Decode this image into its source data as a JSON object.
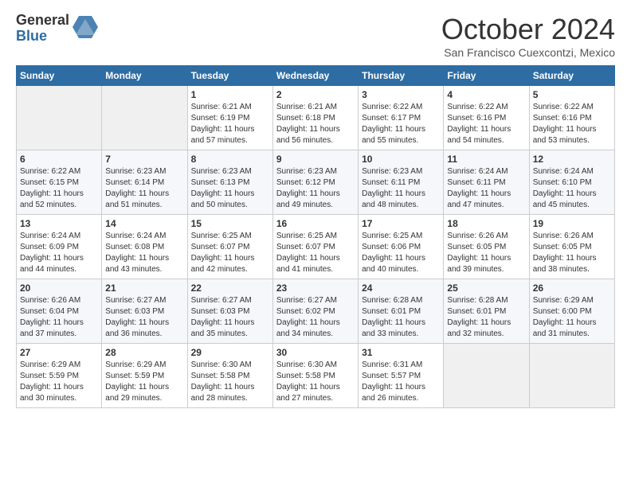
{
  "logo": {
    "general": "General",
    "blue": "Blue"
  },
  "title": "October 2024",
  "subtitle": "San Francisco Cuexcontzi, Mexico",
  "days_of_week": [
    "Sunday",
    "Monday",
    "Tuesday",
    "Wednesday",
    "Thursday",
    "Friday",
    "Saturday"
  ],
  "weeks": [
    [
      {
        "day": "",
        "info": ""
      },
      {
        "day": "",
        "info": ""
      },
      {
        "day": "1",
        "info": "Sunrise: 6:21 AM\nSunset: 6:19 PM\nDaylight: 11 hours and 57 minutes."
      },
      {
        "day": "2",
        "info": "Sunrise: 6:21 AM\nSunset: 6:18 PM\nDaylight: 11 hours and 56 minutes."
      },
      {
        "day": "3",
        "info": "Sunrise: 6:22 AM\nSunset: 6:17 PM\nDaylight: 11 hours and 55 minutes."
      },
      {
        "day": "4",
        "info": "Sunrise: 6:22 AM\nSunset: 6:16 PM\nDaylight: 11 hours and 54 minutes."
      },
      {
        "day": "5",
        "info": "Sunrise: 6:22 AM\nSunset: 6:16 PM\nDaylight: 11 hours and 53 minutes."
      }
    ],
    [
      {
        "day": "6",
        "info": "Sunrise: 6:22 AM\nSunset: 6:15 PM\nDaylight: 11 hours and 52 minutes."
      },
      {
        "day": "7",
        "info": "Sunrise: 6:23 AM\nSunset: 6:14 PM\nDaylight: 11 hours and 51 minutes."
      },
      {
        "day": "8",
        "info": "Sunrise: 6:23 AM\nSunset: 6:13 PM\nDaylight: 11 hours and 50 minutes."
      },
      {
        "day": "9",
        "info": "Sunrise: 6:23 AM\nSunset: 6:12 PM\nDaylight: 11 hours and 49 minutes."
      },
      {
        "day": "10",
        "info": "Sunrise: 6:23 AM\nSunset: 6:11 PM\nDaylight: 11 hours and 48 minutes."
      },
      {
        "day": "11",
        "info": "Sunrise: 6:24 AM\nSunset: 6:11 PM\nDaylight: 11 hours and 47 minutes."
      },
      {
        "day": "12",
        "info": "Sunrise: 6:24 AM\nSunset: 6:10 PM\nDaylight: 11 hours and 45 minutes."
      }
    ],
    [
      {
        "day": "13",
        "info": "Sunrise: 6:24 AM\nSunset: 6:09 PM\nDaylight: 11 hours and 44 minutes."
      },
      {
        "day": "14",
        "info": "Sunrise: 6:24 AM\nSunset: 6:08 PM\nDaylight: 11 hours and 43 minutes."
      },
      {
        "day": "15",
        "info": "Sunrise: 6:25 AM\nSunset: 6:07 PM\nDaylight: 11 hours and 42 minutes."
      },
      {
        "day": "16",
        "info": "Sunrise: 6:25 AM\nSunset: 6:07 PM\nDaylight: 11 hours and 41 minutes."
      },
      {
        "day": "17",
        "info": "Sunrise: 6:25 AM\nSunset: 6:06 PM\nDaylight: 11 hours and 40 minutes."
      },
      {
        "day": "18",
        "info": "Sunrise: 6:26 AM\nSunset: 6:05 PM\nDaylight: 11 hours and 39 minutes."
      },
      {
        "day": "19",
        "info": "Sunrise: 6:26 AM\nSunset: 6:05 PM\nDaylight: 11 hours and 38 minutes."
      }
    ],
    [
      {
        "day": "20",
        "info": "Sunrise: 6:26 AM\nSunset: 6:04 PM\nDaylight: 11 hours and 37 minutes."
      },
      {
        "day": "21",
        "info": "Sunrise: 6:27 AM\nSunset: 6:03 PM\nDaylight: 11 hours and 36 minutes."
      },
      {
        "day": "22",
        "info": "Sunrise: 6:27 AM\nSunset: 6:03 PM\nDaylight: 11 hours and 35 minutes."
      },
      {
        "day": "23",
        "info": "Sunrise: 6:27 AM\nSunset: 6:02 PM\nDaylight: 11 hours and 34 minutes."
      },
      {
        "day": "24",
        "info": "Sunrise: 6:28 AM\nSunset: 6:01 PM\nDaylight: 11 hours and 33 minutes."
      },
      {
        "day": "25",
        "info": "Sunrise: 6:28 AM\nSunset: 6:01 PM\nDaylight: 11 hours and 32 minutes."
      },
      {
        "day": "26",
        "info": "Sunrise: 6:29 AM\nSunset: 6:00 PM\nDaylight: 11 hours and 31 minutes."
      }
    ],
    [
      {
        "day": "27",
        "info": "Sunrise: 6:29 AM\nSunset: 5:59 PM\nDaylight: 11 hours and 30 minutes."
      },
      {
        "day": "28",
        "info": "Sunrise: 6:29 AM\nSunset: 5:59 PM\nDaylight: 11 hours and 29 minutes."
      },
      {
        "day": "29",
        "info": "Sunrise: 6:30 AM\nSunset: 5:58 PM\nDaylight: 11 hours and 28 minutes."
      },
      {
        "day": "30",
        "info": "Sunrise: 6:30 AM\nSunset: 5:58 PM\nDaylight: 11 hours and 27 minutes."
      },
      {
        "day": "31",
        "info": "Sunrise: 6:31 AM\nSunset: 5:57 PM\nDaylight: 11 hours and 26 minutes."
      },
      {
        "day": "",
        "info": ""
      },
      {
        "day": "",
        "info": ""
      }
    ]
  ]
}
